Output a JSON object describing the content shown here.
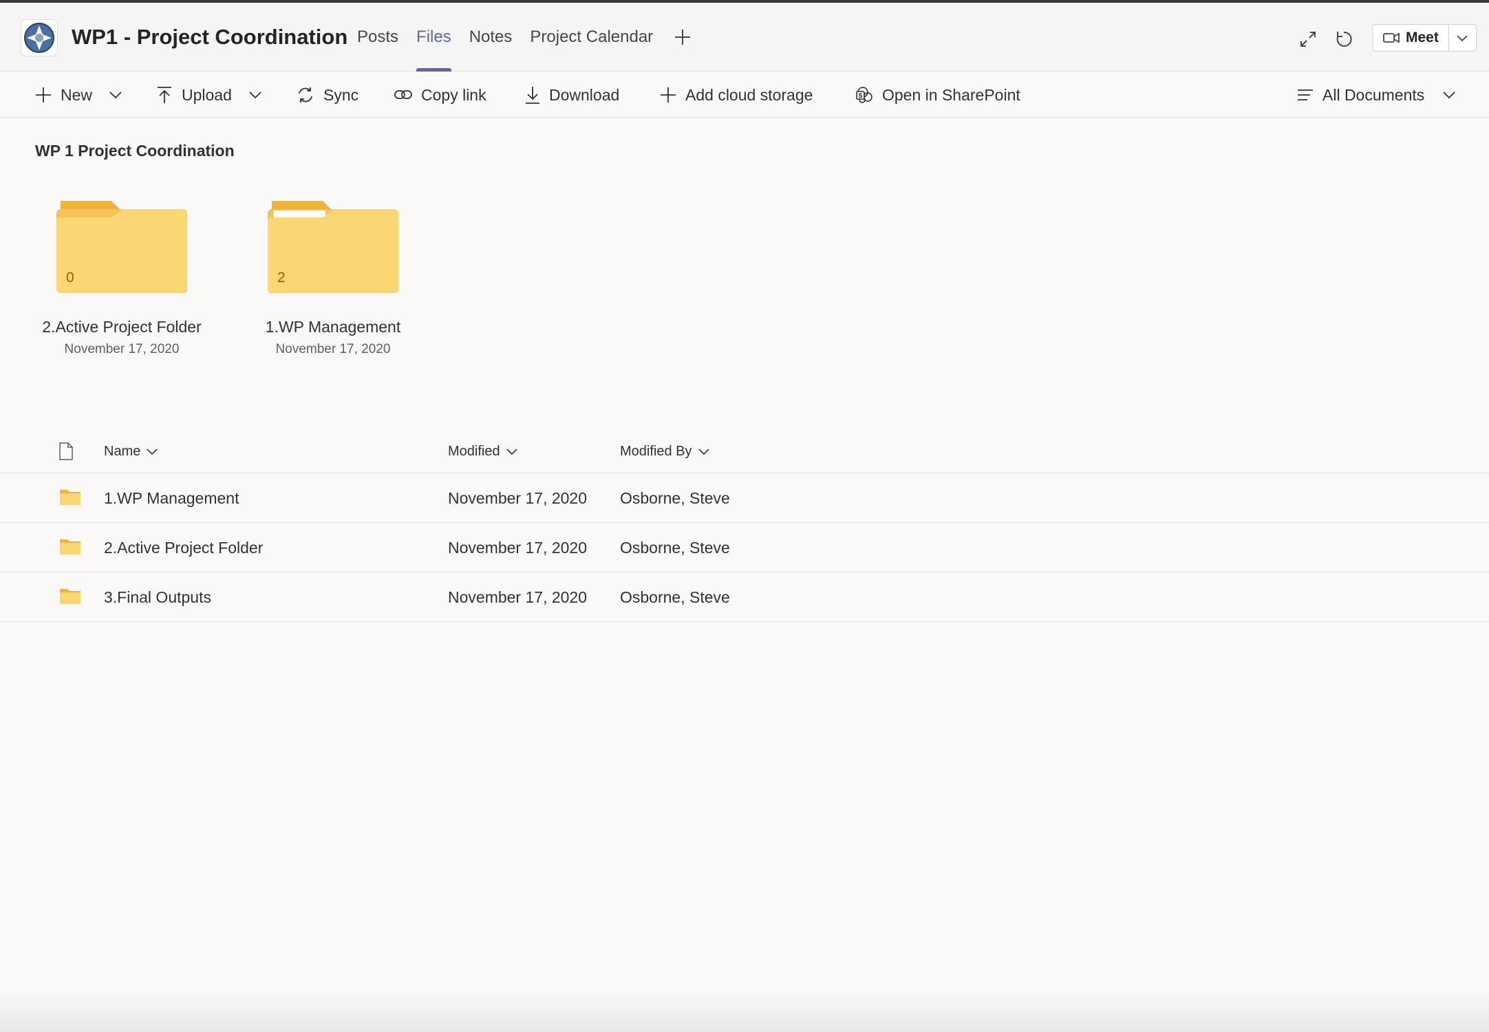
{
  "header": {
    "team_title": "WP1 - Project Coordination",
    "tabs": [
      {
        "label": "Posts",
        "active": false
      },
      {
        "label": "Files",
        "active": true
      },
      {
        "label": "Notes",
        "active": false
      },
      {
        "label": "Project Calendar",
        "active": false
      }
    ],
    "meet_label": "Meet",
    "accent_color": "#6264a7"
  },
  "toolbar": {
    "new_label": "New",
    "upload_label": "Upload",
    "sync_label": "Sync",
    "copy_link_label": "Copy link",
    "download_label": "Download",
    "add_cloud_label": "Add cloud storage",
    "open_sharepoint_label": "Open in SharePoint",
    "view_label": "All Documents"
  },
  "section": {
    "title": "WP 1 Project Coordination"
  },
  "tiles": [
    {
      "name": "2.Active Project Folder",
      "date": "November 17, 2020",
      "count": "0"
    },
    {
      "name": "1.WP Management",
      "date": "November 17, 2020",
      "count": "2"
    }
  ],
  "list": {
    "columns": {
      "name": "Name",
      "modified": "Modified",
      "modified_by": "Modified By"
    },
    "rows": [
      {
        "name": "1.WP Management",
        "modified": "November 17, 2020",
        "modified_by": "Osborne, Steve"
      },
      {
        "name": "2.Active Project Folder",
        "modified": "November 17, 2020",
        "modified_by": "Osborne, Steve"
      },
      {
        "name": "3.Final Outputs",
        "modified": "November 17, 2020",
        "modified_by": "Osborne, Steve"
      }
    ]
  }
}
